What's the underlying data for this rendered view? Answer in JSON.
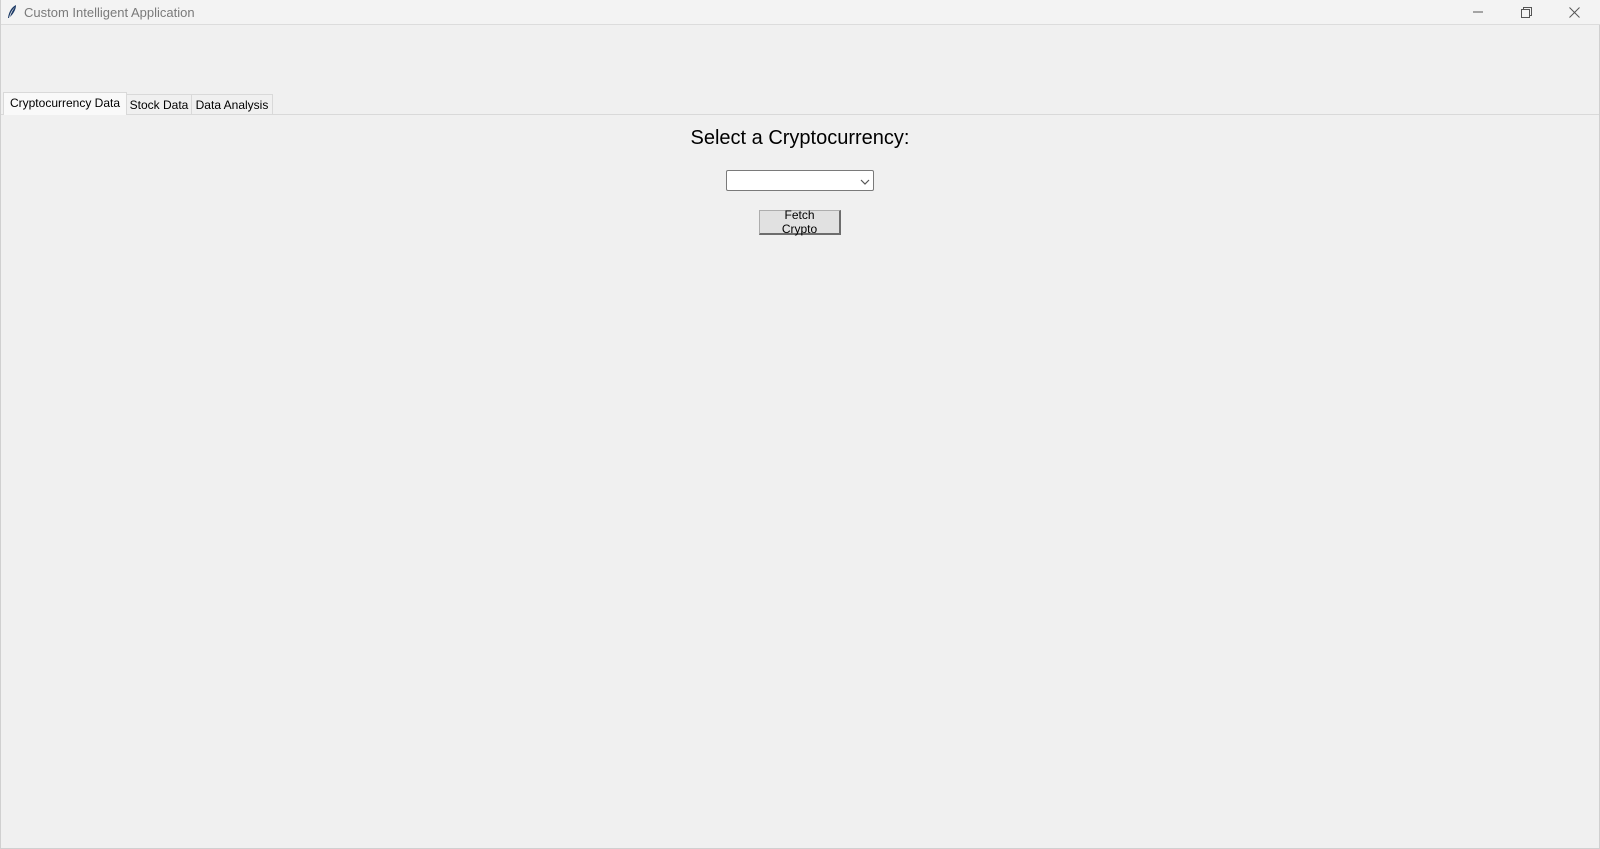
{
  "window": {
    "title": "Custom Intelligent Application",
    "controls": {
      "minimize_icon": "minimize-icon",
      "maximize_icon": "restore-icon",
      "close_icon": "close-icon"
    }
  },
  "tabs": [
    {
      "label": "Cryptocurrency Data",
      "active": true
    },
    {
      "label": "Stock Data",
      "active": false
    },
    {
      "label": "Data Analysis",
      "active": false
    }
  ],
  "crypto_panel": {
    "heading": "Select a Cryptocurrency:",
    "combo_value": "",
    "fetch_button_label": "Fetch Crypto"
  },
  "colors": {
    "background": "#f0f0f0",
    "title_text": "#7a7a7a"
  }
}
